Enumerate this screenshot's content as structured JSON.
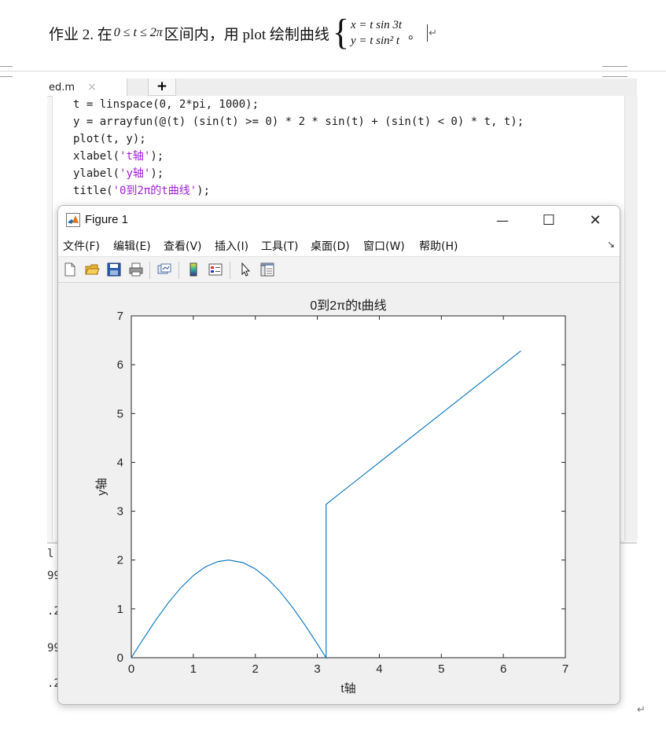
{
  "document": {
    "prefix": "作业 2.  在",
    "range_text": "0 ≤ t ≤ 2π",
    "middle": "区间内，用 plot 绘制曲线",
    "eq_x": "x = t sin 3t",
    "eq_y": "y = t sin² t",
    "period": "。"
  },
  "editor": {
    "tab_name": "ed.m",
    "tab_close": "×",
    "tab_add": "+",
    "code_lines": [
      "t = linspace(0, 2*pi, 1000);",
      "y = arrayfun(@(t) (sin(t) >= 0) * 2 * sin(t) + (sin(t) < 0) * t, t);",
      "plot(t, y);",
      "xlabel(",
      "ylabel(",
      "title("
    ],
    "xlabel_str": "'t轴'",
    "ylabel_str": "'y轴'",
    "title_str": "'0到2π的t曲线'",
    "close_paren": ");",
    "cmd_fragments": [
      "l",
      "99",
      ".2",
      "99",
      ".2"
    ]
  },
  "figure": {
    "title": "Figure 1",
    "minimize": "—",
    "maximize": "☐",
    "close": "✕",
    "menus": [
      "文件(F)",
      "编辑(E)",
      "查看(V)",
      "插入(I)",
      "工具(T)",
      "桌面(D)",
      "窗口(W)",
      "帮助(H)"
    ],
    "menu_arrow": "↘",
    "toolbar_icons": [
      "new-file-icon",
      "open-folder-icon",
      "save-icon",
      "print-icon",
      "link-plot-icon",
      "colorbar-icon",
      "legend-icon",
      "pointer-icon",
      "property-inspector-icon"
    ]
  },
  "chart_data": {
    "type": "line",
    "title": "0到2π的t曲线",
    "xlabel": "t轴",
    "ylabel": "y轴",
    "xlim": [
      0,
      7
    ],
    "ylim": [
      0,
      7
    ],
    "xticks": [
      0,
      1,
      2,
      3,
      4,
      5,
      6,
      7
    ],
    "yticks": [
      0,
      1,
      2,
      3,
      4,
      5,
      6,
      7
    ],
    "grid": false,
    "series": [
      {
        "color": "#0072bd",
        "x": [
          0,
          0.2,
          0.4,
          0.6,
          0.8,
          1.0,
          1.2,
          1.4,
          1.5708,
          1.8,
          2.0,
          2.2,
          2.4,
          2.6,
          2.8,
          3.0,
          3.1416,
          3.1416,
          3.5,
          4.0,
          4.5,
          5.0,
          5.5,
          6.0,
          6.2832
        ],
        "y": [
          0,
          0.397,
          0.779,
          1.129,
          1.435,
          1.683,
          1.864,
          1.971,
          2.0,
          1.948,
          1.819,
          1.617,
          1.351,
          1.031,
          0.67,
          0.282,
          0,
          3.1416,
          3.5,
          4.0,
          4.5,
          5.0,
          5.5,
          6.0,
          6.2832
        ]
      }
    ]
  }
}
